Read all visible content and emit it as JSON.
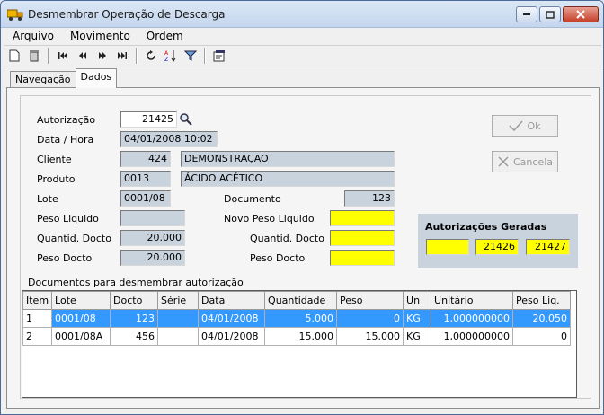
{
  "window": {
    "title": "Desmembrar Operação de Descarga"
  },
  "menu": [
    {
      "label": "Arquivo"
    },
    {
      "label": "Movimento"
    },
    {
      "label": "Ordem"
    }
  ],
  "tabs": [
    {
      "label": "Navegação"
    },
    {
      "label": "Dados"
    }
  ],
  "form": {
    "autorizacao_label": "Autorização",
    "autorizacao_value": "21425",
    "datahora_label": "Data / Hora",
    "datahora_value": "04/01/2008 10:02",
    "cliente_label": "Cliente",
    "cliente_code": "424",
    "cliente_name": "DEMONSTRAÇAO",
    "produto_label": "Produto",
    "produto_code": "0013",
    "produto_name": "ÁCIDO ACÉTICO",
    "lote_label": "Lote",
    "lote_value": "0001/08",
    "documento_label": "Documento",
    "documento_value": "123",
    "peso_liquido_label": "Peso Liquido",
    "peso_liquido_value": "",
    "novo_peso_liquido_label": "Novo Peso Liquido",
    "novo_peso_liquido_value": "",
    "quantid_docto_label": "Quantid. Docto",
    "quantid_docto_value": "20.000",
    "quantid_docto2_label": "Quantid. Docto",
    "quantid_docto2_value": "",
    "peso_docto_label": "Peso Docto",
    "peso_docto_value": "20.000",
    "peso_docto2_label": "Peso Docto",
    "peso_docto2_value": ""
  },
  "buttons": {
    "ok": "Ok",
    "cancela": "Cancela"
  },
  "autorizacoes": {
    "title": "Autorizações Geradas",
    "values": [
      "",
      "21426",
      "21427"
    ]
  },
  "grid": {
    "caption": "Documentos para desmembrar autorização",
    "columns": [
      "Item",
      "Lote",
      "Docto",
      "Série",
      "Data",
      "Quantidade",
      "Peso",
      "Un",
      "Unitário",
      "Peso Liq."
    ],
    "rows": [
      [
        "1",
        "0001/08",
        "123",
        "",
        "04/01/2008",
        "5.000",
        "0",
        "KG",
        "1,000000000",
        "20.050"
      ],
      [
        "2",
        "0001/08A",
        "456",
        "",
        "04/01/2008",
        "15.000",
        "15.000",
        "KG",
        "1,000000000",
        "0"
      ]
    ]
  },
  "colors": {
    "field_gray": "#c9d3de",
    "highlight_yellow": "#ffff00",
    "selection_blue": "#3399ff"
  }
}
